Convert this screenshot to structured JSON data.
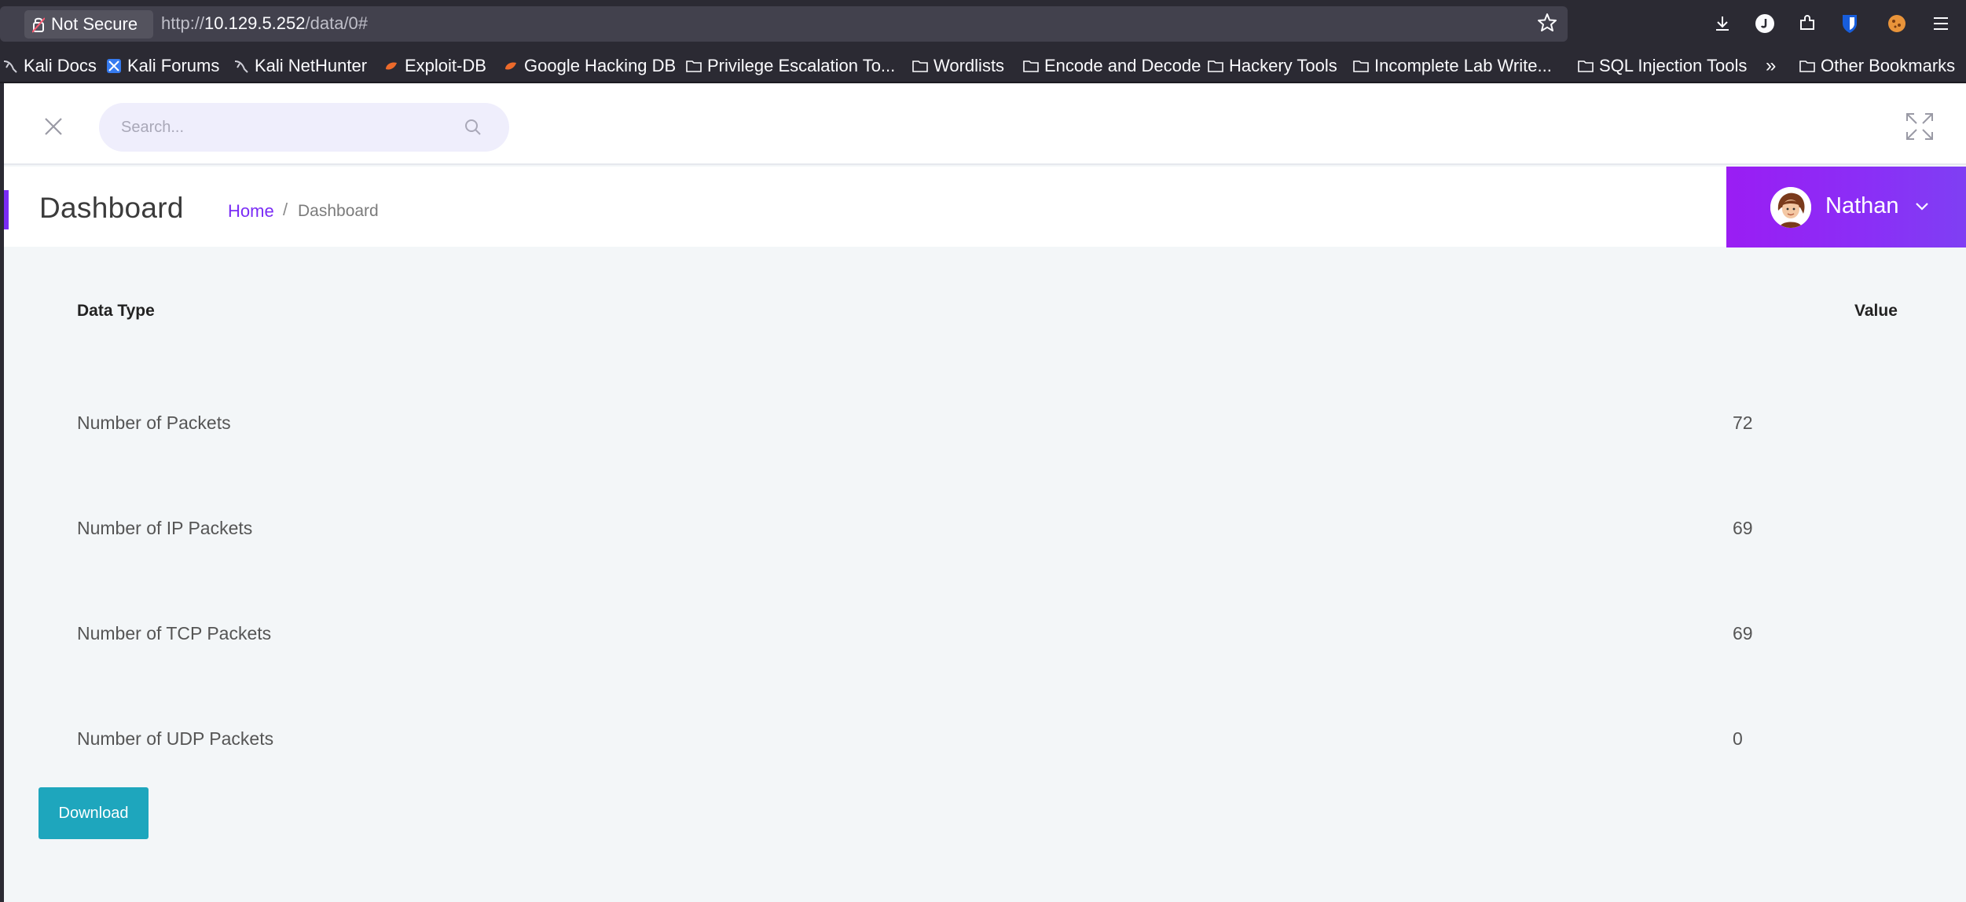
{
  "browser": {
    "security_label": "Not Secure",
    "url_scheme": "http://",
    "url_host": "10.129.5.252",
    "url_path": "/data/0#",
    "bookmarks": [
      {
        "label": "Kali Docs",
        "icon": "kali-dragon-icon"
      },
      {
        "label": "Kali Forums",
        "icon": "kali-forums-icon"
      },
      {
        "label": "Kali NetHunter",
        "icon": "kali-dragon-icon"
      },
      {
        "label": "Exploit-DB",
        "icon": "exploit-db-icon"
      },
      {
        "label": "Google Hacking DB",
        "icon": "exploit-db-icon"
      },
      {
        "label": "Privilege Escalation To...",
        "icon": "folder-icon"
      },
      {
        "label": "Wordlists",
        "icon": "folder-icon"
      },
      {
        "label": "Encode and Decode",
        "icon": "folder-icon"
      },
      {
        "label": "Hackery Tools",
        "icon": "folder-icon"
      },
      {
        "label": "Incomplete Lab Write...",
        "icon": "folder-icon"
      },
      {
        "label": "SQL Injection Tools",
        "icon": "folder-icon"
      },
      {
        "label": "Other Bookmarks",
        "icon": "folder-icon"
      }
    ],
    "overflow_label": "»"
  },
  "topnav": {
    "search_placeholder": "Search..."
  },
  "header": {
    "title": "Dashboard",
    "breadcrumb_home": "Home",
    "breadcrumb_sep": "/",
    "breadcrumb_current": "Dashboard",
    "user_name": "Nathan"
  },
  "table": {
    "col_type": "Data Type",
    "col_value": "Value",
    "rows": [
      {
        "label": "Number of Packets",
        "value": "72"
      },
      {
        "label": "Number of IP Packets",
        "value": "69"
      },
      {
        "label": "Number of TCP Packets",
        "value": "69"
      },
      {
        "label": "Number of UDP Packets",
        "value": "0"
      }
    ]
  },
  "actions": {
    "download_label": "Download"
  },
  "colors": {
    "accent": "#7a2cf5",
    "button": "#1ea6bd",
    "user_panel": "#9a1df3"
  }
}
